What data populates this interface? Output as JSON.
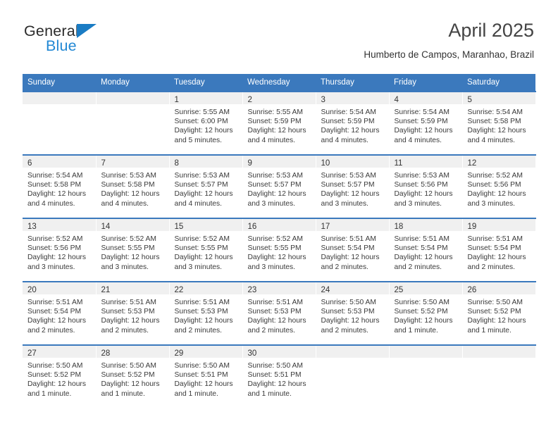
{
  "logo": {
    "word_dark": "General",
    "word_blue": "Blue",
    "triangle_color": "#1a7cc4",
    "blue_color": "#2288d4"
  },
  "header": {
    "title": "April 2025",
    "subtitle": "Humberto de Campos, Maranhao, Brazil"
  },
  "theme": {
    "header_blue": "#3b79bd",
    "daynum_band": "#f0f0f0",
    "text": "#3a3a3a"
  },
  "calendar": {
    "weekday_headers": [
      "Sunday",
      "Monday",
      "Tuesday",
      "Wednesday",
      "Thursday",
      "Friday",
      "Saturday"
    ],
    "weeks": [
      [
        {
          "day": ""
        },
        {
          "day": ""
        },
        {
          "day": "1",
          "sunrise": "Sunrise: 5:55 AM",
          "sunset": "Sunset: 6:00 PM",
          "daylight1": "Daylight: 12 hours",
          "daylight2": "and 5 minutes."
        },
        {
          "day": "2",
          "sunrise": "Sunrise: 5:55 AM",
          "sunset": "Sunset: 5:59 PM",
          "daylight1": "Daylight: 12 hours",
          "daylight2": "and 4 minutes."
        },
        {
          "day": "3",
          "sunrise": "Sunrise: 5:54 AM",
          "sunset": "Sunset: 5:59 PM",
          "daylight1": "Daylight: 12 hours",
          "daylight2": "and 4 minutes."
        },
        {
          "day": "4",
          "sunrise": "Sunrise: 5:54 AM",
          "sunset": "Sunset: 5:59 PM",
          "daylight1": "Daylight: 12 hours",
          "daylight2": "and 4 minutes."
        },
        {
          "day": "5",
          "sunrise": "Sunrise: 5:54 AM",
          "sunset": "Sunset: 5:58 PM",
          "daylight1": "Daylight: 12 hours",
          "daylight2": "and 4 minutes."
        }
      ],
      [
        {
          "day": "6",
          "sunrise": "Sunrise: 5:54 AM",
          "sunset": "Sunset: 5:58 PM",
          "daylight1": "Daylight: 12 hours",
          "daylight2": "and 4 minutes."
        },
        {
          "day": "7",
          "sunrise": "Sunrise: 5:53 AM",
          "sunset": "Sunset: 5:58 PM",
          "daylight1": "Daylight: 12 hours",
          "daylight2": "and 4 minutes."
        },
        {
          "day": "8",
          "sunrise": "Sunrise: 5:53 AM",
          "sunset": "Sunset: 5:57 PM",
          "daylight1": "Daylight: 12 hours",
          "daylight2": "and 4 minutes."
        },
        {
          "day": "9",
          "sunrise": "Sunrise: 5:53 AM",
          "sunset": "Sunset: 5:57 PM",
          "daylight1": "Daylight: 12 hours",
          "daylight2": "and 3 minutes."
        },
        {
          "day": "10",
          "sunrise": "Sunrise: 5:53 AM",
          "sunset": "Sunset: 5:57 PM",
          "daylight1": "Daylight: 12 hours",
          "daylight2": "and 3 minutes."
        },
        {
          "day": "11",
          "sunrise": "Sunrise: 5:53 AM",
          "sunset": "Sunset: 5:56 PM",
          "daylight1": "Daylight: 12 hours",
          "daylight2": "and 3 minutes."
        },
        {
          "day": "12",
          "sunrise": "Sunrise: 5:52 AM",
          "sunset": "Sunset: 5:56 PM",
          "daylight1": "Daylight: 12 hours",
          "daylight2": "and 3 minutes."
        }
      ],
      [
        {
          "day": "13",
          "sunrise": "Sunrise: 5:52 AM",
          "sunset": "Sunset: 5:56 PM",
          "daylight1": "Daylight: 12 hours",
          "daylight2": "and 3 minutes."
        },
        {
          "day": "14",
          "sunrise": "Sunrise: 5:52 AM",
          "sunset": "Sunset: 5:55 PM",
          "daylight1": "Daylight: 12 hours",
          "daylight2": "and 3 minutes."
        },
        {
          "day": "15",
          "sunrise": "Sunrise: 5:52 AM",
          "sunset": "Sunset: 5:55 PM",
          "daylight1": "Daylight: 12 hours",
          "daylight2": "and 3 minutes."
        },
        {
          "day": "16",
          "sunrise": "Sunrise: 5:52 AM",
          "sunset": "Sunset: 5:55 PM",
          "daylight1": "Daylight: 12 hours",
          "daylight2": "and 3 minutes."
        },
        {
          "day": "17",
          "sunrise": "Sunrise: 5:51 AM",
          "sunset": "Sunset: 5:54 PM",
          "daylight1": "Daylight: 12 hours",
          "daylight2": "and 2 minutes."
        },
        {
          "day": "18",
          "sunrise": "Sunrise: 5:51 AM",
          "sunset": "Sunset: 5:54 PM",
          "daylight1": "Daylight: 12 hours",
          "daylight2": "and 2 minutes."
        },
        {
          "day": "19",
          "sunrise": "Sunrise: 5:51 AM",
          "sunset": "Sunset: 5:54 PM",
          "daylight1": "Daylight: 12 hours",
          "daylight2": "and 2 minutes."
        }
      ],
      [
        {
          "day": "20",
          "sunrise": "Sunrise: 5:51 AM",
          "sunset": "Sunset: 5:54 PM",
          "daylight1": "Daylight: 12 hours",
          "daylight2": "and 2 minutes."
        },
        {
          "day": "21",
          "sunrise": "Sunrise: 5:51 AM",
          "sunset": "Sunset: 5:53 PM",
          "daylight1": "Daylight: 12 hours",
          "daylight2": "and 2 minutes."
        },
        {
          "day": "22",
          "sunrise": "Sunrise: 5:51 AM",
          "sunset": "Sunset: 5:53 PM",
          "daylight1": "Daylight: 12 hours",
          "daylight2": "and 2 minutes."
        },
        {
          "day": "23",
          "sunrise": "Sunrise: 5:51 AM",
          "sunset": "Sunset: 5:53 PM",
          "daylight1": "Daylight: 12 hours",
          "daylight2": "and 2 minutes."
        },
        {
          "day": "24",
          "sunrise": "Sunrise: 5:50 AM",
          "sunset": "Sunset: 5:53 PM",
          "daylight1": "Daylight: 12 hours",
          "daylight2": "and 2 minutes."
        },
        {
          "day": "25",
          "sunrise": "Sunrise: 5:50 AM",
          "sunset": "Sunset: 5:52 PM",
          "daylight1": "Daylight: 12 hours",
          "daylight2": "and 1 minute."
        },
        {
          "day": "26",
          "sunrise": "Sunrise: 5:50 AM",
          "sunset": "Sunset: 5:52 PM",
          "daylight1": "Daylight: 12 hours",
          "daylight2": "and 1 minute."
        }
      ],
      [
        {
          "day": "27",
          "sunrise": "Sunrise: 5:50 AM",
          "sunset": "Sunset: 5:52 PM",
          "daylight1": "Daylight: 12 hours",
          "daylight2": "and 1 minute."
        },
        {
          "day": "28",
          "sunrise": "Sunrise: 5:50 AM",
          "sunset": "Sunset: 5:52 PM",
          "daylight1": "Daylight: 12 hours",
          "daylight2": "and 1 minute."
        },
        {
          "day": "29",
          "sunrise": "Sunrise: 5:50 AM",
          "sunset": "Sunset: 5:51 PM",
          "daylight1": "Daylight: 12 hours",
          "daylight2": "and 1 minute."
        },
        {
          "day": "30",
          "sunrise": "Sunrise: 5:50 AM",
          "sunset": "Sunset: 5:51 PM",
          "daylight1": "Daylight: 12 hours",
          "daylight2": "and 1 minute."
        },
        {
          "day": ""
        },
        {
          "day": ""
        },
        {
          "day": ""
        }
      ]
    ]
  }
}
